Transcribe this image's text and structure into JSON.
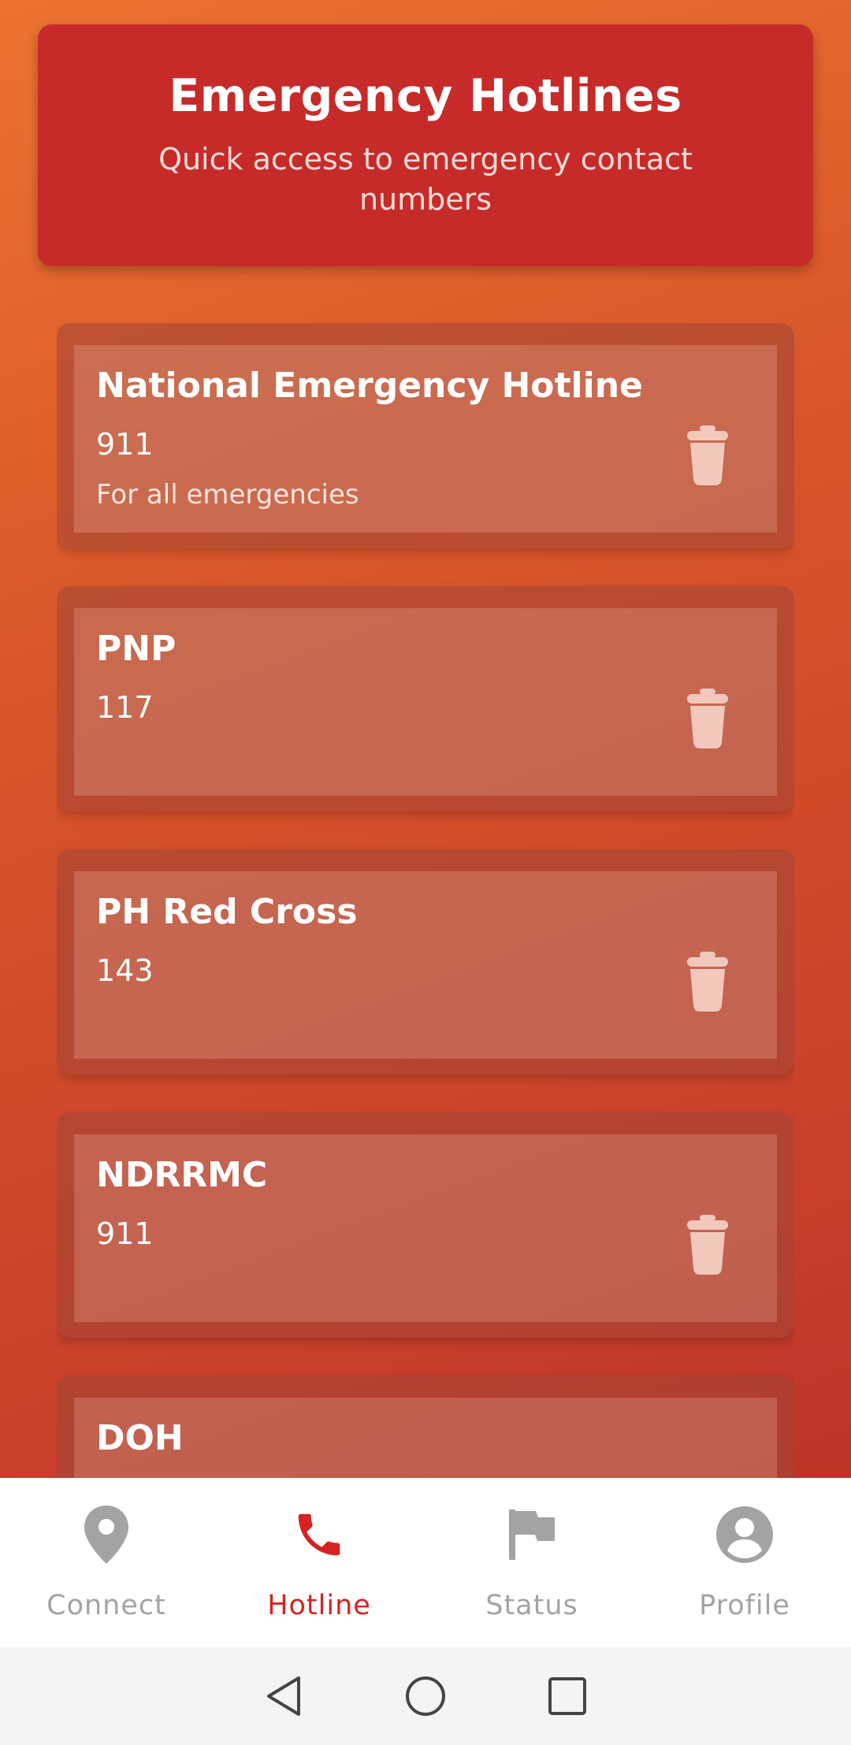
{
  "header": {
    "title": "Emergency Hotlines",
    "subtitle": "Quick access to emergency contact numbers"
  },
  "hotlines": [
    {
      "name": "National Emergency Hotline",
      "number": "911",
      "description": "For all emergencies",
      "delete_icon": "trash-icon"
    },
    {
      "name": "PNP",
      "number": "117",
      "description": "",
      "delete_icon": "trash-icon"
    },
    {
      "name": "PH Red Cross",
      "number": "143",
      "description": "",
      "delete_icon": "trash-icon"
    },
    {
      "name": "NDRRMC",
      "number": "911",
      "description": "",
      "delete_icon": "trash-icon"
    },
    {
      "name": "DOH",
      "number": "",
      "description": "",
      "delete_icon": "trash-icon"
    }
  ],
  "bottom_nav": {
    "active": "Hotline",
    "items": [
      {
        "label": "Connect",
        "icon": "location-pin-icon"
      },
      {
        "label": "Hotline",
        "icon": "phone-icon"
      },
      {
        "label": "Status",
        "icon": "flag-icon"
      },
      {
        "label": "Profile",
        "icon": "account-circle-icon"
      }
    ]
  },
  "system_nav": {
    "buttons": [
      "back-icon",
      "home-icon",
      "recents-icon"
    ]
  },
  "colors": {
    "header_bg": "#c62b2a",
    "active_nav": "#d62222",
    "inactive_nav": "#a3a3a3"
  }
}
